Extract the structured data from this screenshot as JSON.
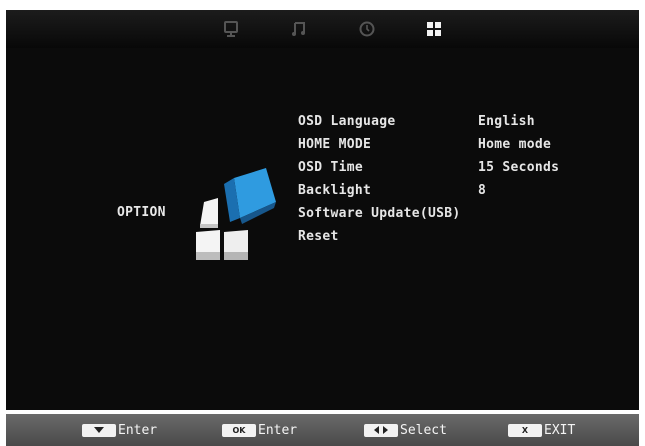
{
  "top_tabs": [
    {
      "icon": "monitor-icon",
      "active": false
    },
    {
      "icon": "music-note-icon",
      "active": false
    },
    {
      "icon": "clock-icon",
      "active": false
    },
    {
      "icon": "option-grid-icon",
      "active": true
    }
  ],
  "section": {
    "label": "OPTION",
    "icon": "option-cubes-icon"
  },
  "menu": [
    {
      "label": "OSD Language",
      "value": "English"
    },
    {
      "label": "HOME MODE",
      "value": "Home mode"
    },
    {
      "label": "OSD Time",
      "value": "15 Seconds"
    },
    {
      "label": "Backlight",
      "value": "8"
    },
    {
      "label": "Software Update(USB)",
      "value": ""
    },
    {
      "label": "Reset",
      "value": ""
    }
  ],
  "footer": {
    "hints": [
      {
        "key": "",
        "key_icon": "down-arrow-icon",
        "text": "Enter"
      },
      {
        "key": "OK",
        "key_icon": "",
        "text": "Enter"
      },
      {
        "key": "",
        "key_icon": "left-right-arrows-icon",
        "text": "Select"
      },
      {
        "key": "X",
        "key_icon": "",
        "text": "EXIT"
      }
    ]
  },
  "colors": {
    "background": "#0b0b0b",
    "text": "#e6e6e6",
    "accent_blue": "#2f9be0",
    "footer": "#5a5a5a"
  }
}
